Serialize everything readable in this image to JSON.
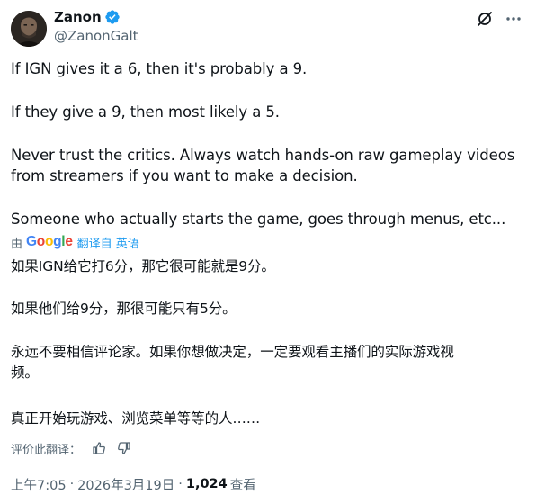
{
  "author": {
    "display_name": "Zanon",
    "handle": "@ZanonGalt"
  },
  "icons": {
    "avatar": "user-avatar",
    "verified": "verified-badge-icon",
    "grok": "grok-icon",
    "more": "more-options-icon",
    "thumbs_up": "thumbs-up-icon",
    "thumbs_down": "thumbs-down-icon"
  },
  "colors": {
    "accent": "#1d9bf0",
    "text": "#0f1419",
    "secondary": "#536471"
  },
  "tweet": {
    "original": [
      "If IGN gives it a 6, then it's probably a 9.",
      "If they give a 9, then most likely a 5.",
      "Never trust the critics. Always watch hands-on raw gameplay videos\nfrom streamers if you want to make a decision.",
      "Someone who actually starts the game, goes through menus, etc..."
    ],
    "translation_attribution": {
      "prefix": "由",
      "provider": "Google",
      "suffix": "翻译自 英语"
    },
    "translated": [
      "如果IGN给它打6分，那它很可能就是9分。",
      "如果他们给9分，那很可能只有5分。",
      "永远不要相信评论家。如果你想做决定，一定要观看主播们的实际游戏视\n频。",
      "真正开始玩游戏、浏览菜单等等的人……"
    ],
    "rate_translation_label": "评价此翻译："
  },
  "meta": {
    "time": "上午7:05",
    "separator": "·",
    "date": "2026年3月19日",
    "views_count": "1,024",
    "views_label": "查看"
  }
}
